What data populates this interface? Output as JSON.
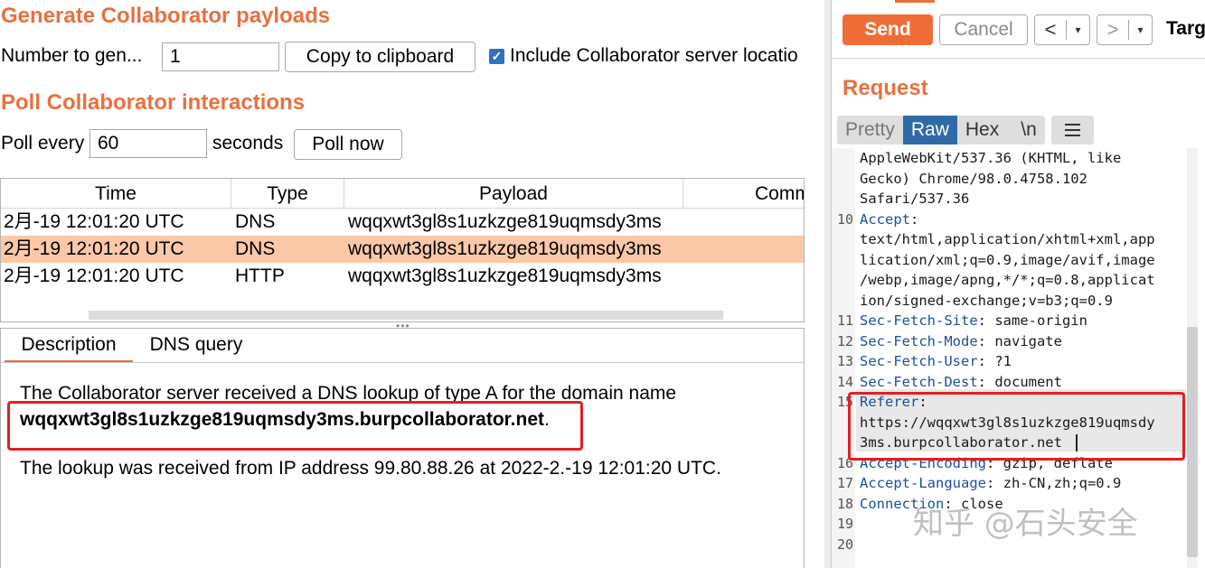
{
  "generate": {
    "title": "Generate Collaborator payloads",
    "number_label": "Number to gen...",
    "number_value": "1",
    "copy_button": "Copy to clipboard",
    "include_label": "Include Collaborator server locatio",
    "include_checked": true
  },
  "poll": {
    "title": "Poll Collaborator interactions",
    "every_label": "Poll every",
    "every_value": "60",
    "seconds_label": "seconds",
    "poll_now_button": "Poll now"
  },
  "table": {
    "columns": [
      "Time",
      "Type",
      "Payload",
      "Comm"
    ],
    "rows": [
      {
        "time": "2月-19 12:01:20 UTC",
        "type": "DNS",
        "payload": "wqqxwt3gl8s1uzkzge819uqmsdy3ms"
      },
      {
        "time": "2月-19 12:01:20 UTC",
        "type": "DNS",
        "payload": "wqqxwt3gl8s1uzkzge819uqmsdy3ms"
      },
      {
        "time": "2月-19 12:01:20 UTC",
        "type": "HTTP",
        "payload": "wqqxwt3gl8s1uzkzge819uqmsdy3ms"
      }
    ],
    "selected_row_color": "#fbc8a8"
  },
  "detail": {
    "tabs": [
      "Description",
      "DNS query"
    ],
    "line1": "The Collaborator server received a DNS lookup of type A for the domain name",
    "domain": "wqqxwt3gl8s1uzkzge819uqmsdy3ms.burpcollaborator.net",
    "domain_suffix": ".",
    "line3": "The lookup was received from IP address 99.80.88.26 at 2022-2.-19 12:01:20 UTC."
  },
  "request_panel": {
    "send_button": "Send",
    "cancel_button": "Cancel",
    "back_arrow": "<",
    "forward_arrow": ">",
    "dropdown_glyph": "▾",
    "target_label": "Targ",
    "title": "Request",
    "view_tabs": [
      "Pretty",
      "Raw",
      "Hex",
      "\\n"
    ],
    "active_view": "Raw",
    "accent_color": "#e8703f",
    "send_color": "#f06c37"
  },
  "editor": {
    "lines": [
      {
        "num": "",
        "segments": [
          {
            "t": "AppleWebKit/537.36 (KHTML, like",
            "k": false
          }
        ]
      },
      {
        "num": "",
        "segments": [
          {
            "t": "Gecko) Chrome/98.0.4758.102",
            "k": false
          }
        ]
      },
      {
        "num": "",
        "segments": [
          {
            "t": "Safari/537.36",
            "k": false
          }
        ]
      },
      {
        "num": "10",
        "segments": [
          {
            "t": "Accept",
            "k": true
          },
          {
            "t": ":",
            "k": false
          }
        ]
      },
      {
        "num": "",
        "segments": [
          {
            "t": "text/html,application/xhtml+xml,app",
            "k": false
          }
        ]
      },
      {
        "num": "",
        "segments": [
          {
            "t": "lication/xml;q=0.9,image/avif,image",
            "k": false
          }
        ]
      },
      {
        "num": "",
        "segments": [
          {
            "t": "/webp,image/apng,*/*;q=0.8,applicat",
            "k": false
          }
        ]
      },
      {
        "num": "",
        "segments": [
          {
            "t": "ion/signed-exchange;v=b3;q=0.9",
            "k": false
          }
        ]
      },
      {
        "num": "11",
        "segments": [
          {
            "t": "Sec-Fetch-Site",
            "k": true
          },
          {
            "t": ": same-origin",
            "k": false
          }
        ]
      },
      {
        "num": "12",
        "segments": [
          {
            "t": "Sec-Fetch-Mode",
            "k": true
          },
          {
            "t": ": navigate",
            "k": false
          }
        ]
      },
      {
        "num": "13",
        "segments": [
          {
            "t": "Sec-Fetch-User",
            "k": true
          },
          {
            "t": ": ?1",
            "k": false
          }
        ]
      },
      {
        "num": "14",
        "segments": [
          {
            "t": "Sec-Fetch-Dest",
            "k": true
          },
          {
            "t": ": document",
            "k": false
          }
        ]
      },
      {
        "num": "15",
        "segments": [
          {
            "t": "Referer",
            "k": true
          },
          {
            "t": ":",
            "k": false
          }
        ]
      },
      {
        "num": "",
        "segments": [
          {
            "t": "https://wqqxwt3gl8s1uzkzge819uqmsdy",
            "k": false
          }
        ]
      },
      {
        "num": "",
        "segments": [
          {
            "t": "3ms.burpcollaborator.net",
            "k": false
          }
        ]
      },
      {
        "num": "16",
        "segments": [
          {
            "t": "Accept-Encoding",
            "k": true
          },
          {
            "t": ": gzip, deflate",
            "k": false
          }
        ]
      },
      {
        "num": "17",
        "segments": [
          {
            "t": "Accept-Language",
            "k": true
          },
          {
            "t": ": zh-CN,zh;q=0.9",
            "k": false
          }
        ]
      },
      {
        "num": "18",
        "segments": [
          {
            "t": "Connection",
            "k": true
          },
          {
            "t": ": close",
            "k": false
          }
        ]
      },
      {
        "num": "19",
        "segments": []
      },
      {
        "num": "20",
        "segments": []
      }
    ]
  },
  "watermark": "知乎 @石头安全"
}
